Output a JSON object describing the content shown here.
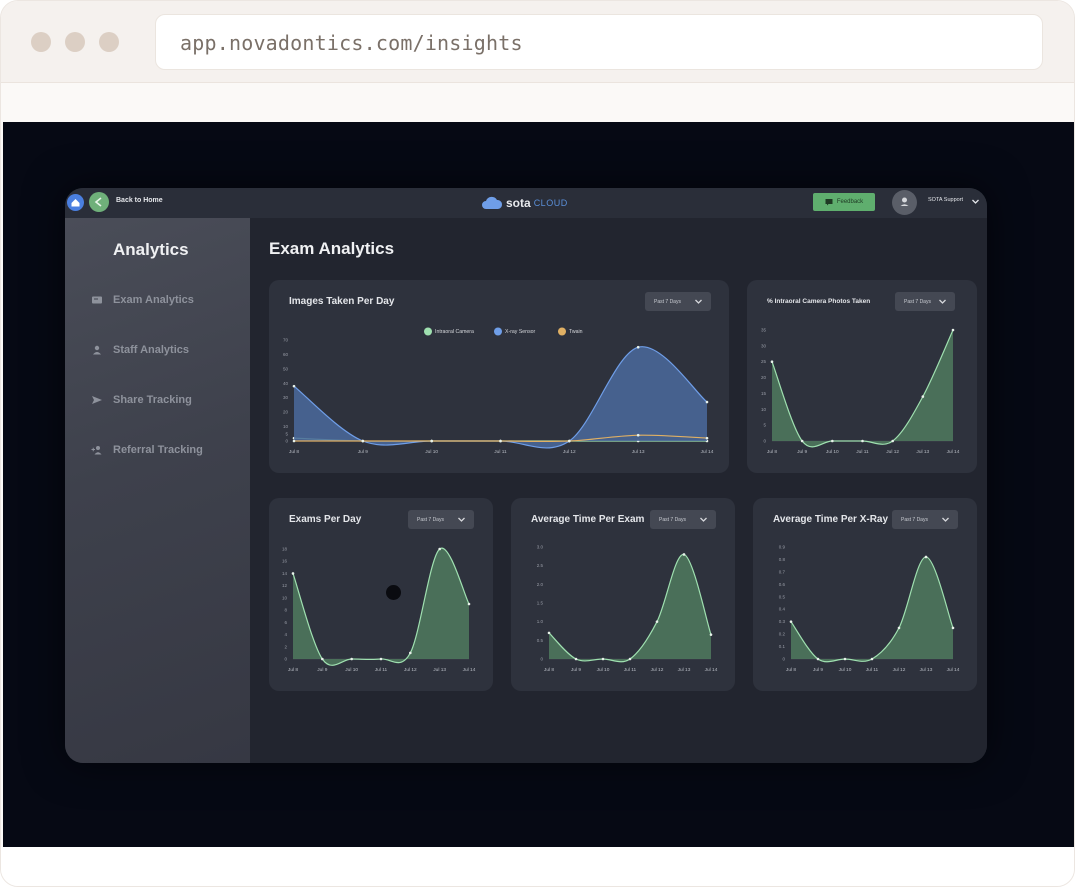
{
  "browser": {
    "url": "app.novadontics.com/insights"
  },
  "topbar": {
    "back_label": "Back to Home",
    "logo_text": "sota",
    "logo_cloud": "CLOUD",
    "feedback_label": "Feedback",
    "user_name": "SOTA Support"
  },
  "sidebar": {
    "title": "Analytics",
    "items": [
      {
        "label": "Exam Analytics"
      },
      {
        "label": "Staff Analytics"
      },
      {
        "label": "Share Tracking"
      },
      {
        "label": "Referral Tracking"
      }
    ]
  },
  "main": {
    "title": "Exam Analytics"
  },
  "colors": {
    "green": "#9fe0b0",
    "blue": "#6f9ee8",
    "orange": "#e0b064",
    "fill_green": "#4f7a5e",
    "fill_blue": "#4a6a9c"
  },
  "dropdown_label": "Past 7 Days",
  "cards": [
    {
      "title": "Images Taken Per Day"
    },
    {
      "title": "% Intraoral Camera Photos Taken"
    },
    {
      "title": "Exams Per Day"
    },
    {
      "title": "Average Time Per Exam"
    },
    {
      "title": "Average Time Per X-Ray"
    }
  ],
  "chart_data": [
    {
      "type": "area",
      "title": "Images Taken Per Day",
      "categories": [
        "Jul 8",
        "Jul 9",
        "Jul 10",
        "Jul 11",
        "Jul 12",
        "Jul 13",
        "Jul 14"
      ],
      "yticks": [
        "0",
        "5",
        "10",
        "20",
        "30",
        "40",
        "50",
        "60",
        "70"
      ],
      "ylim": [
        0,
        70
      ],
      "legend": [
        "Intraoral Camera",
        "X-ray Sensor",
        "Twain"
      ],
      "series": [
        {
          "name": "Intraoral Camera",
          "values": [
            2,
            0,
            0,
            0,
            0,
            0,
            0
          ],
          "color": "#9fe0b0"
        },
        {
          "name": "X-ray Sensor",
          "values": [
            38,
            0,
            0,
            0,
            0,
            65,
            27
          ],
          "color": "#6f9ee8"
        },
        {
          "name": "Twain",
          "values": [
            0,
            0,
            0,
            0,
            0,
            4,
            2
          ],
          "color": "#e0b064"
        }
      ]
    },
    {
      "type": "area",
      "title": "% Intraoral Camera Photos Taken",
      "categories": [
        "Jul 8",
        "Jul 9",
        "Jul 10",
        "Jul 11",
        "Jul 12",
        "Jul 13",
        "Jul 14"
      ],
      "yticks": [
        "0",
        "5",
        "10",
        "15",
        "20",
        "25",
        "30",
        "35"
      ],
      "ylim": [
        0,
        35
      ],
      "values": [
        25,
        0,
        0,
        0,
        0,
        14,
        35
      ]
    },
    {
      "type": "area",
      "title": "Exams Per Day",
      "categories": [
        "Jul 8",
        "Jul 9",
        "Jul 10",
        "Jul 11",
        "Jul 12",
        "Jul 13",
        "Jul 14"
      ],
      "yticks": [
        "0",
        "2",
        "4",
        "6",
        "8",
        "10",
        "12",
        "14",
        "16",
        "18"
      ],
      "ylim": [
        0,
        18
      ],
      "values": [
        14,
        0,
        0,
        0,
        1,
        18,
        9
      ]
    },
    {
      "type": "area",
      "title": "Average Time Per Exam",
      "categories": [
        "Jul 8",
        "Jul 9",
        "Jul 10",
        "Jul 11",
        "Jul 12",
        "Jul 13",
        "Jul 14"
      ],
      "yticks": [
        "0",
        "0.5",
        "1.0",
        "1.5",
        "2.0",
        "2.5",
        "3.0"
      ],
      "ylim": [
        0,
        3.0
      ],
      "values": [
        0.7,
        0,
        0,
        0,
        1.0,
        2.8,
        0.65
      ]
    },
    {
      "type": "area",
      "title": "Average Time Per X-Ray",
      "categories": [
        "Jul 8",
        "Jul 9",
        "Jul 10",
        "Jul 11",
        "Jul 12",
        "Jul 13",
        "Jul 14"
      ],
      "yticks": [
        "0",
        "0.1",
        "0.2",
        "0.3",
        "0.4",
        "0.5",
        "0.6",
        "0.7",
        "0.8",
        "0.9"
      ],
      "ylim": [
        0,
        0.9
      ],
      "values": [
        0.3,
        0,
        0,
        0,
        0.25,
        0.82,
        0.25
      ]
    }
  ]
}
